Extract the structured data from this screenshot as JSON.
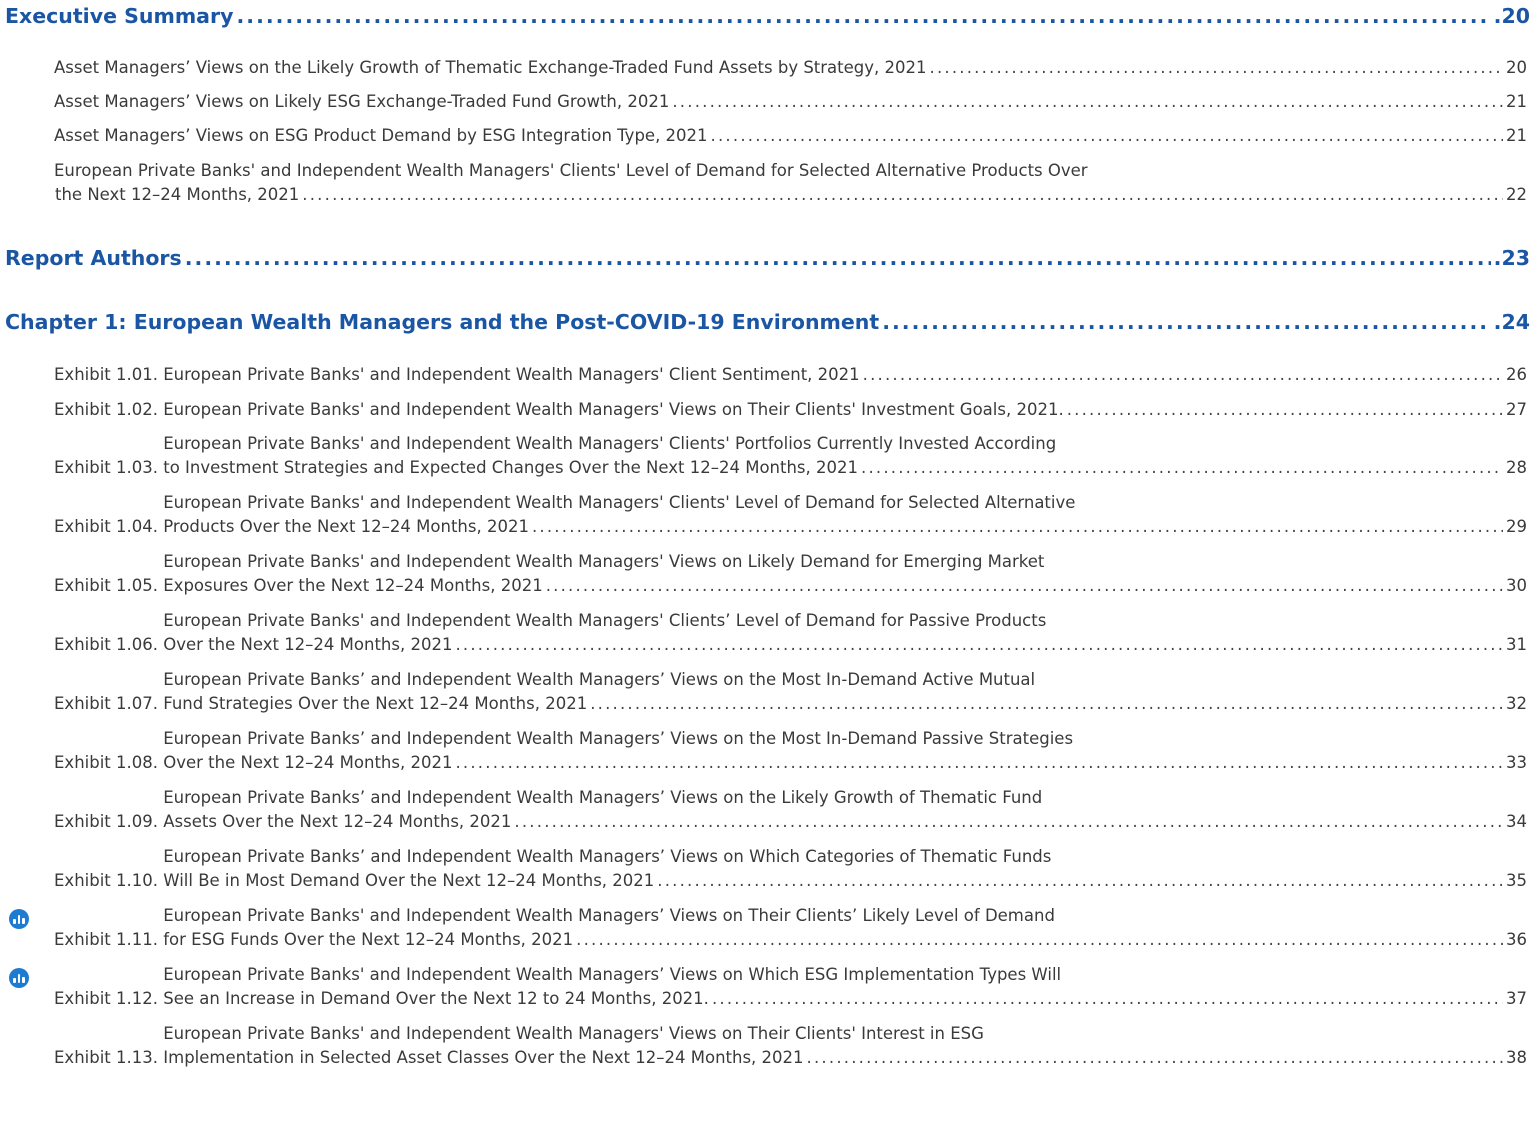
{
  "toc": {
    "executive_summary": {
      "title": "Executive Summary",
      "page": ".20"
    },
    "es_items": [
      {
        "line1": "Asset Managers’ Views on the Likely Growth of Thematic Exchange-Traded Fund Assets by Strategy, 2021",
        "page": "20"
      },
      {
        "line1": "Asset Managers’ Views on Likely ESG Exchange-Traded Fund Growth, 2021",
        "page": "21"
      },
      {
        "line1": "Asset Managers’ Views on ESG Product Demand by ESG Integration Type, 2021",
        "page": "21"
      },
      {
        "line1": "European Private Banks' and Independent Wealth Managers' Clients' Level of Demand for Selected Alternative Products Over",
        "line2": "the Next 12–24 Months, 2021",
        "page": "22"
      }
    ],
    "report_authors": {
      "title": "Report Authors",
      "page": ".23"
    },
    "chapter1": {
      "title": "Chapter 1: European Wealth Managers and the Post-COVID-19 Environment",
      "page": ".24"
    },
    "exhibits": [
      {
        "num": "Exhibit 1.01.",
        "line1": "European Private Banks' and Independent Wealth Managers' Client Sentiment, 2021",
        "page": "26"
      },
      {
        "num": "Exhibit 1.02.",
        "line1": "European Private Banks' and Independent Wealth Managers' Views on Their Clients' Investment Goals, 2021.",
        "page": "27"
      },
      {
        "num": "Exhibit 1.03.",
        "line1": "European Private Banks' and Independent Wealth Managers' Clients' Portfolios Currently Invested According",
        "line2": "to Investment Strategies and Expected Changes Over the Next 12–24 Months, 2021",
        "page": "28"
      },
      {
        "num": "Exhibit 1.04.",
        "line1": "European Private Banks' and Independent Wealth Managers' Clients' Level of Demand for Selected Alternative",
        "line2": "Products Over the Next 12–24 Months, 2021",
        "page": "29"
      },
      {
        "num": "Exhibit 1.05.",
        "line1": "European Private Banks' and Independent Wealth Managers' Views on Likely Demand for Emerging Market",
        "line2": "Exposures Over the Next 12–24 Months, 2021",
        "page": "30"
      },
      {
        "num": "Exhibit 1.06.",
        "line1": "European Private Banks' and Independent Wealth Managers' Clients’ Level of Demand for Passive Products",
        "line2": "Over the Next 12–24 Months, 2021",
        "page": "31"
      },
      {
        "num": "Exhibit 1.07.",
        "line1": "European Private Banks’ and Independent Wealth Managers’ Views on the Most In-Demand Active Mutual",
        "line2": "Fund Strategies Over the Next 12–24 Months, 2021",
        "page": "32"
      },
      {
        "num": "Exhibit 1.08.",
        "line1": "European Private Banks’ and Independent Wealth Managers’ Views on the Most In-Demand Passive Strategies",
        "line2": "Over the Next 12–24 Months, 2021",
        "page": "33"
      },
      {
        "num": "Exhibit 1.09.",
        "line1": "European Private Banks’ and Independent Wealth Managers’ Views on the Likely Growth of Thematic Fund",
        "line2": "Assets Over the Next 12–24 Months, 2021",
        "page": "34"
      },
      {
        "num": "Exhibit 1.10.",
        "line1": "European Private Banks’ and Independent Wealth Managers’ Views on Which Categories of Thematic Funds",
        "line2": "Will Be in Most Demand Over the Next 12–24 Months, 2021",
        "page": "35"
      },
      {
        "num": "Exhibit 1.11.",
        "line1": "European Private Banks' and Independent Wealth Managers’ Views on Their Clients’ Likely Level of Demand",
        "line2": "for ESG Funds Over the Next 12–24 Months, 2021",
        "page": "36",
        "icon": "bar-chart-icon"
      },
      {
        "num": "Exhibit 1.12.",
        "line1": "European Private Banks' and Independent Wealth Managers’ Views on Which ESG Implementation Types Will",
        "line2": "See an Increase in Demand Over the Next 12 to 24 Months, 2021.",
        "page": "37",
        "icon": "bar-chart-icon"
      },
      {
        "num": "Exhibit 1.13.",
        "line1": "European Private Banks' and Independent Wealth Managers' Views on Their Clients' Interest in ESG",
        "line2": "Implementation in Selected Asset Classes Over the Next 12–24 Months, 2021",
        "page": "38"
      }
    ]
  },
  "colors": {
    "heading": "#1b56a4",
    "icon": "#1e7bd2",
    "text": "#3a3a3a"
  }
}
